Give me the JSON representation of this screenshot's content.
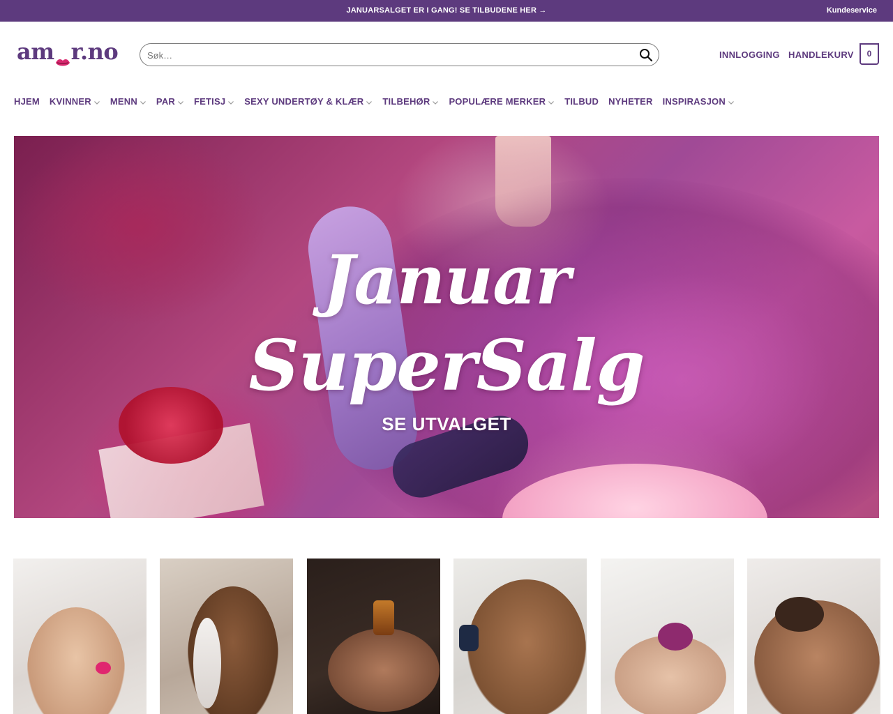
{
  "topbar": {
    "promo": "JANUARSALGET ER I GANG! SE TILBUDENE HER →",
    "customer_service": "Kundeservice"
  },
  "header": {
    "logo_left": "am",
    "logo_right": "r.no",
    "search_placeholder": "Søk…",
    "login": "INNLOGGING",
    "cart": "HANDLEKURV",
    "cart_count": "0"
  },
  "nav": {
    "items": [
      {
        "label": "HJEM",
        "dropdown": false
      },
      {
        "label": "KVINNER",
        "dropdown": true
      },
      {
        "label": "MENN",
        "dropdown": true
      },
      {
        "label": "PAR",
        "dropdown": true
      },
      {
        "label": "FETISJ",
        "dropdown": true
      },
      {
        "label": "SEXY UNDERTØY & KLÆR",
        "dropdown": true
      },
      {
        "label": "TILBEHØR",
        "dropdown": true
      },
      {
        "label": "POPULÆRE MERKER",
        "dropdown": true
      },
      {
        "label": "TILBUD",
        "dropdown": false
      },
      {
        "label": "NYHETER",
        "dropdown": false
      },
      {
        "label": "INSPIRASJON",
        "dropdown": true
      }
    ]
  },
  "hero": {
    "title_line1": "Januar",
    "title_line2": "SuperSalg",
    "cta": "SE UTVALGET"
  },
  "colors": {
    "brand": "#5d3a7e",
    "lips": "#d8286e"
  },
  "tiles": [
    {
      "name": "woman-lingerie"
    },
    {
      "name": "woman-wand"
    },
    {
      "name": "massage-oil"
    },
    {
      "name": "man-bed"
    },
    {
      "name": "toy-hands"
    },
    {
      "name": "couple"
    }
  ]
}
